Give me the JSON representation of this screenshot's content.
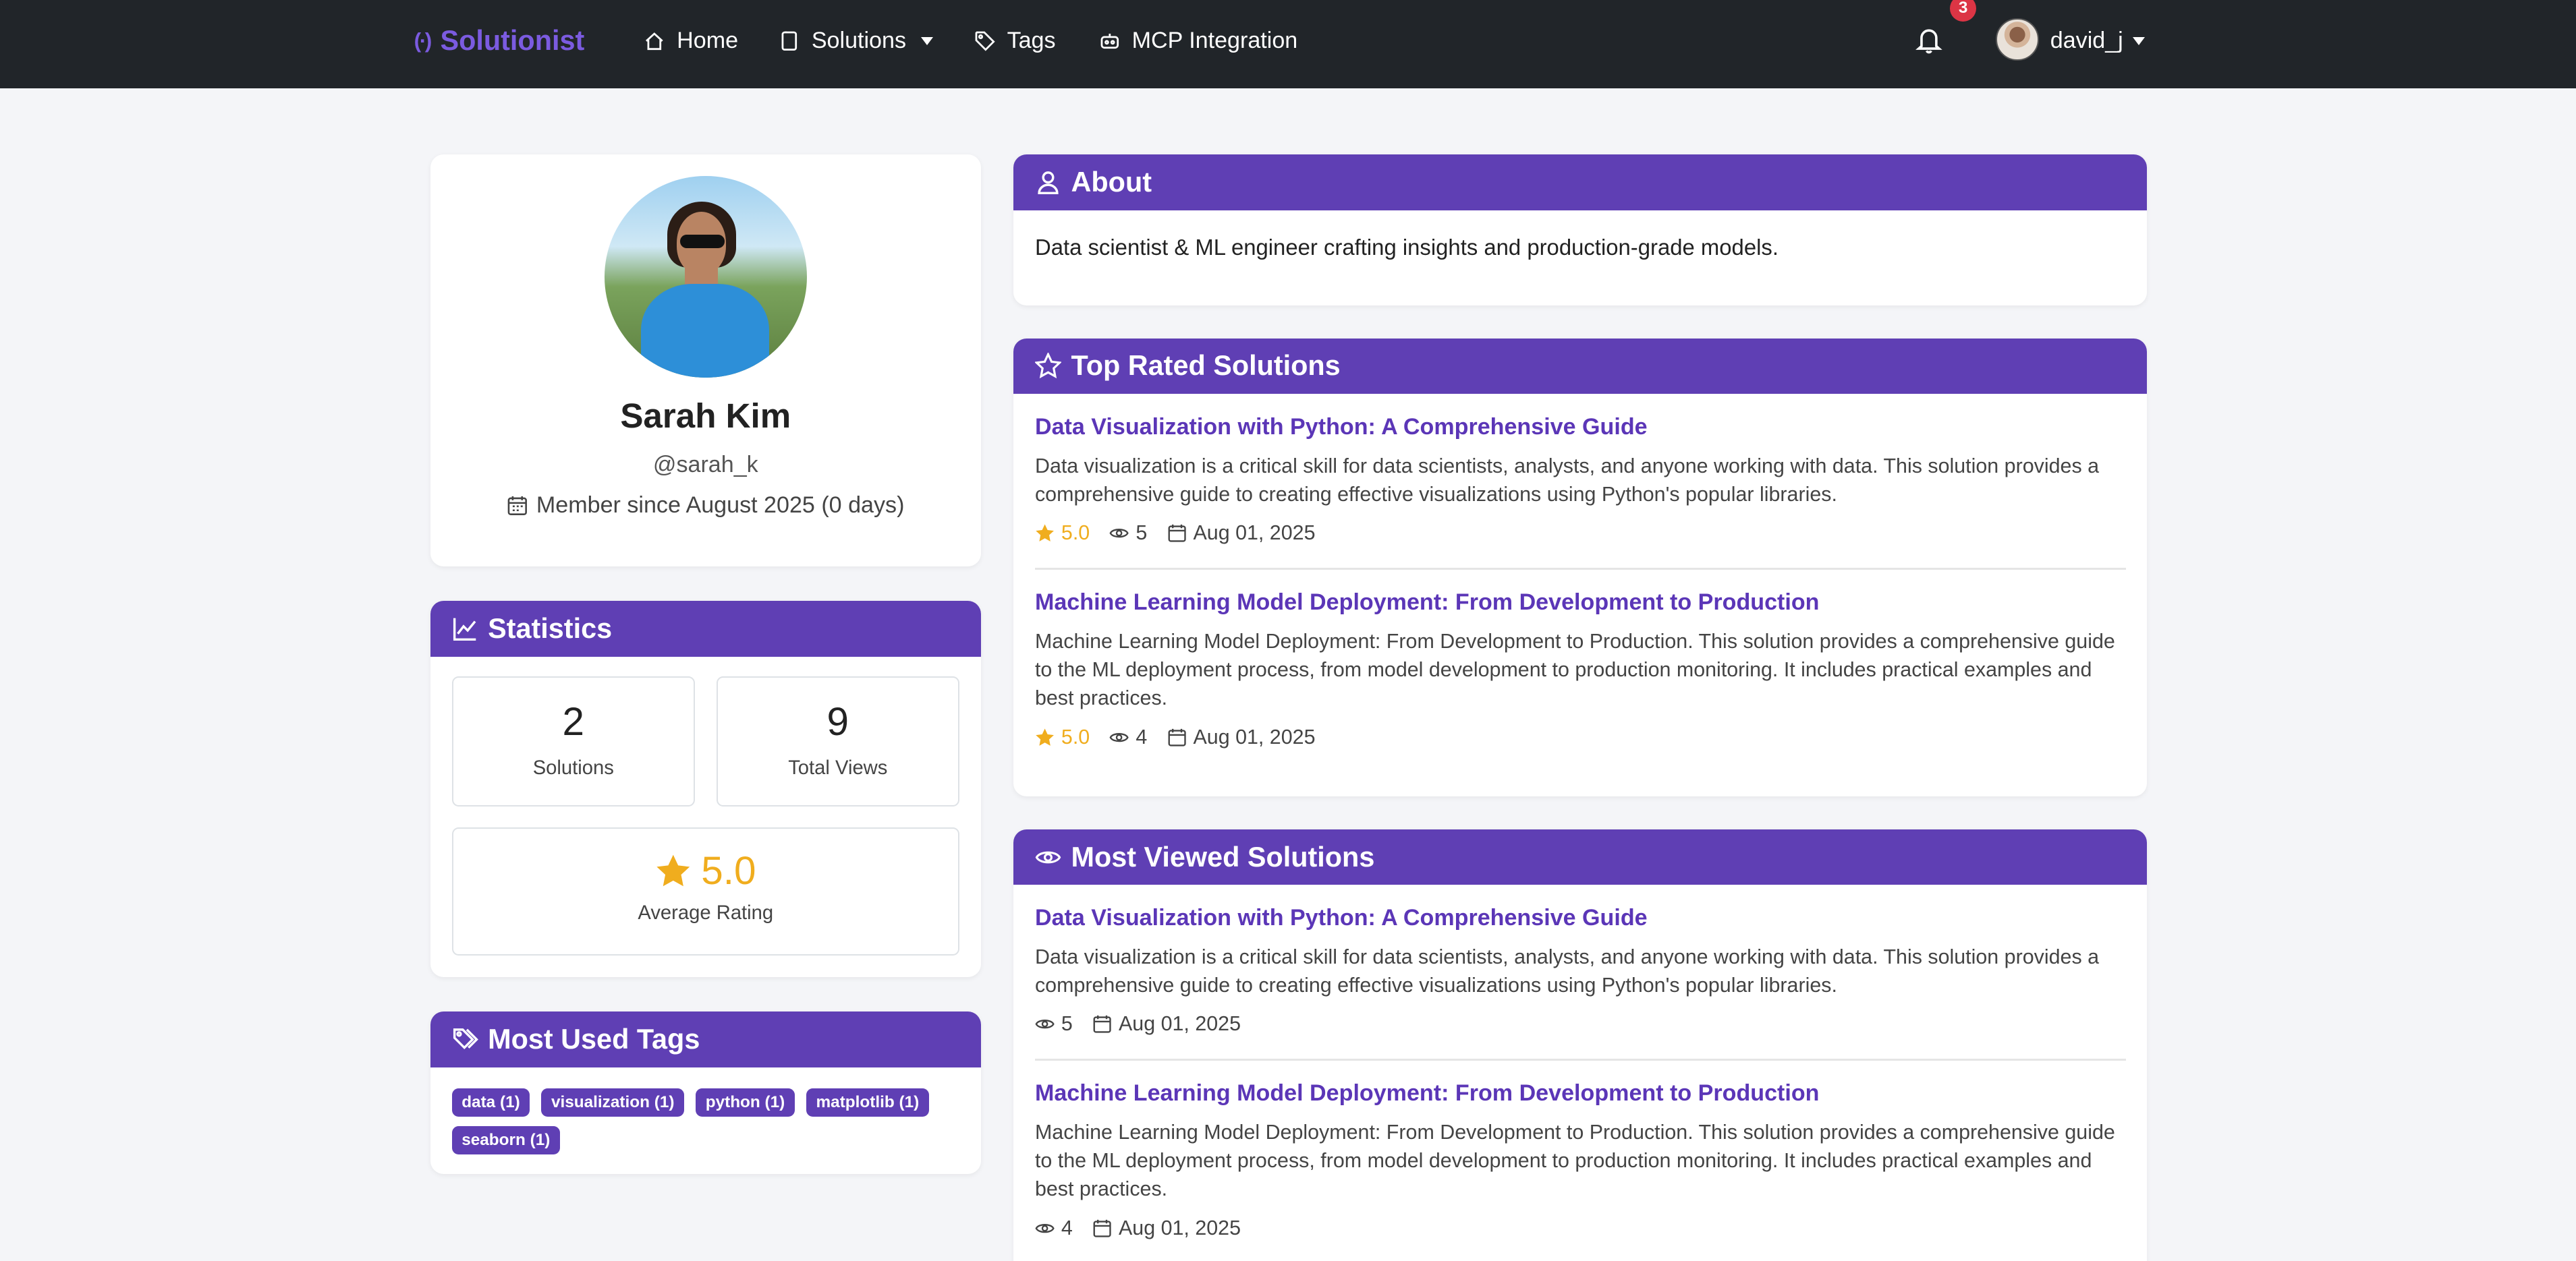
{
  "navbar": {
    "brand": "Solutionist",
    "brand_icon": "(·)",
    "links": [
      {
        "label": "Home",
        "icon": "home-icon"
      },
      {
        "label": "Solutions",
        "icon": "file-icon",
        "dropdown": true
      },
      {
        "label": "Tags",
        "icon": "tag-icon"
      },
      {
        "label": "MCP Integration",
        "icon": "robot-icon"
      }
    ],
    "notification_count": "3",
    "username": "david_j"
  },
  "profile": {
    "name": "Sarah Kim",
    "handle": "@sarah_k",
    "member_since": "Member since August 2025 (0 days)"
  },
  "statistics": {
    "title": "Statistics",
    "solutions_count": "2",
    "solutions_label": "Solutions",
    "views_count": "9",
    "views_label": "Total Views",
    "average_rating": "5.0",
    "rating_label": "Average Rating"
  },
  "tags_card": {
    "title": "Most Used Tags",
    "tags": [
      "data (1)",
      "visualization (1)",
      "python (1)",
      "matplotlib (1)",
      "seaborn (1)"
    ]
  },
  "about": {
    "title": "About",
    "text": "Data scientist & ML engineer crafting insights and production-grade models."
  },
  "top_rated": {
    "title": "Top Rated Solutions",
    "items": [
      {
        "title": "Data Visualization with Python: A Comprehensive Guide",
        "description": "Data visualization is a critical skill for data scientists, analysts, and anyone working with data. This solution provides a comprehensive guide to creating effective visualizations using Python's popular libraries.",
        "rating": "5.0",
        "views": "5",
        "date": "Aug 01, 2025"
      },
      {
        "title": "Machine Learning Model Deployment: From Development to Production",
        "description": "Machine Learning Model Deployment: From Development to Production. This solution provides a comprehensive guide to the ML deployment process, from model development to production monitoring. It includes practical examples and best practices.",
        "rating": "5.0",
        "views": "4",
        "date": "Aug 01, 2025"
      }
    ]
  },
  "most_viewed": {
    "title": "Most Viewed Solutions",
    "items": [
      {
        "title": "Data Visualization with Python: A Comprehensive Guide",
        "description": "Data visualization is a critical skill for data scientists, analysts, and anyone working with data. This solution provides a comprehensive guide to creating effective visualizations using Python's popular libraries.",
        "views": "5",
        "date": "Aug 01, 2025"
      },
      {
        "title": "Machine Learning Model Deployment: From Development to Production",
        "description": "Machine Learning Model Deployment: From Development to Production. This solution provides a comprehensive guide to the ML deployment process, from model development to production monitoring. It includes practical examples and best practices.",
        "views": "4",
        "date": "Aug 01, 2025"
      }
    ]
  },
  "colors": {
    "accent": "#5f3fb4",
    "link": "#5b36b7",
    "rating": "#f0ad1e",
    "navbar": "#212529",
    "badge": "#dc3545"
  }
}
